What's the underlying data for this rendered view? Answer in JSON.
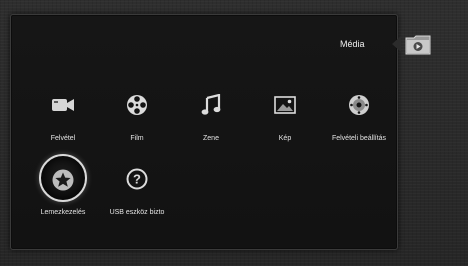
{
  "header": {
    "section_title": "Média",
    "section_icon": "media-folder-icon"
  },
  "menu": {
    "row1": [
      {
        "id": "recording",
        "label": "Felvétel",
        "icon": "camcorder-icon"
      },
      {
        "id": "film",
        "label": "Film",
        "icon": "film-reel-icon"
      },
      {
        "id": "music",
        "label": "Zene",
        "icon": "music-note-icon"
      },
      {
        "id": "picture",
        "label": "Kép",
        "icon": "picture-icon"
      },
      {
        "id": "record-settings",
        "label": "Felvételi beállítás",
        "icon": "disc-settings-icon"
      }
    ],
    "row2": [
      {
        "id": "disk-management",
        "label": "Lemezkezelés",
        "icon": "star-icon",
        "selected": true
      },
      {
        "id": "usb-safe-remove",
        "label": "USB eszköz bizto",
        "icon": "question-icon"
      }
    ]
  },
  "colors": {
    "panel_bg": "#141414",
    "text": "#e6e6e6",
    "selection_ring": "#d9d9d9"
  }
}
